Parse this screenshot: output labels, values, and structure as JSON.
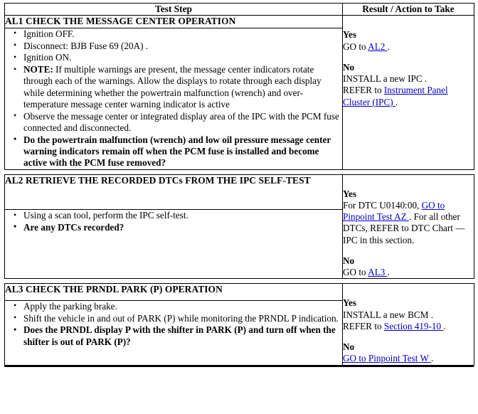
{
  "table": {
    "headers": {
      "test_step": "Test Step",
      "result_action": "Result / Action to Take"
    },
    "sections": [
      {
        "id": "AL1",
        "title": "AL1 CHECK THE MESSAGE CENTER OPERATION",
        "steps": [
          {
            "text": "Ignition OFF.",
            "bold": false
          },
          {
            "text": "Disconnect: BJB Fuse 69 (20A) .",
            "bold": false
          },
          {
            "text": "Ignition ON.",
            "bold": false
          },
          {
            "lead": "NOTE:",
            "text": " If multiple warnings are present, the message center indicators rotate through each of the warnings. Allow the displays to rotate through each display while determining whether the powertrain malfunction (wrench) and over-temperature message center warning indicator is active",
            "bold": false
          },
          {
            "text": "Observe the message center or integrated display area of the IPC with the PCM fuse connected and disconnected.",
            "bold": false
          },
          {
            "text": "Do the powertrain malfunction (wrench) and low oil pressure message center warning indicators remain off when the PCM fuse is installed and become active with the PCM fuse removed?",
            "bold": true
          }
        ],
        "result": {
          "yes_label": "Yes",
          "yes_parts": [
            {
              "t": "GO to ",
              "link": false
            },
            {
              "t": "AL2 ",
              "link": true
            },
            {
              "t": ".",
              "link": false
            }
          ],
          "no_label": "No",
          "no_parts": [
            {
              "t": "INSTALL a new IPC .",
              "link": false,
              "br": true
            },
            {
              "t": "REFER to ",
              "link": false
            },
            {
              "t": "Instrument Panel Cluster (IPC) ",
              "link": true
            },
            {
              "t": ".",
              "link": false
            }
          ]
        }
      },
      {
        "id": "AL2",
        "title": "AL2 RETRIEVE THE RECORDED DTCs FROM THE IPC SELF-TEST",
        "steps": [
          {
            "text": "Using a scan tool, perform the IPC self-test.",
            "bold": false
          },
          {
            "text": "Are any DTCs recorded?",
            "bold": true
          }
        ],
        "result": {
          "yes_label": "Yes",
          "yes_parts": [
            {
              "t": "For DTC U0140:00, ",
              "link": false
            },
            {
              "t": "GO to Pinpoint Test AZ ",
              "link": true
            },
            {
              "t": ". For all other DTCs, REFER to DTC Chart — IPC in this section.",
              "link": false
            }
          ],
          "no_label": "No",
          "no_parts": [
            {
              "t": "GO to ",
              "link": false
            },
            {
              "t": "AL3 ",
              "link": true
            },
            {
              "t": ".",
              "link": false
            }
          ]
        }
      },
      {
        "id": "AL3",
        "title": "AL3 CHECK THE PRNDL PARK (P) OPERATION",
        "steps": [
          {
            "text": "Apply the parking brake.",
            "bold": false
          },
          {
            "text": "Shift the vehicle in and out of PARK (P) while monitoring the PRNDL P indication.",
            "bold": false
          },
          {
            "text": "Does the PRNDL display P with the shifter in PARK (P) and turn off when the shifter is out of PARK (P)?",
            "bold": true
          }
        ],
        "result": {
          "yes_label": "Yes",
          "yes_parts": [
            {
              "t": "INSTALL a new BCM .",
              "link": false,
              "br": true
            },
            {
              "t": "REFER to ",
              "link": false
            },
            {
              "t": "Section 419-10 ",
              "link": true
            },
            {
              "t": ".",
              "link": false
            }
          ],
          "no_label": "No",
          "no_parts": [
            {
              "t": "GO to Pinpoint Test W ",
              "link": true
            },
            {
              "t": ".",
              "link": false
            }
          ]
        }
      }
    ]
  },
  "colors": {
    "link": "#0000c8",
    "border": "#000000",
    "text": "#000000",
    "background": "#ffffff"
  }
}
